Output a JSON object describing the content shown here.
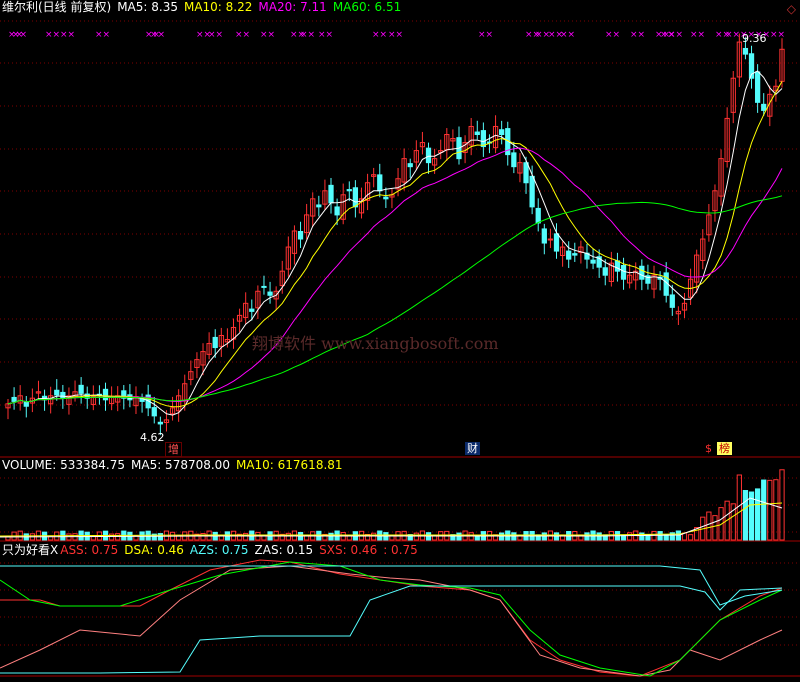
{
  "header": {
    "title": "维尔利(日线 前复权)",
    "ma5": "MA5: 8.35",
    "ma10": "MA10: 8.22",
    "ma20": "MA20: 7.11",
    "ma60": "MA60: 6.51"
  },
  "volume_header": {
    "title": "VOLUME: 533384.75",
    "ma5": "MA5: 578708.00",
    "ma10": "MA10: 617618.81"
  },
  "indicator_header": {
    "title": "只为好看X",
    "ass": "ASS: 0.75",
    "dsa": "DSA: 0.46",
    "azs": "AZS: 0.75",
    "zas": "ZAS: 0.15",
    "sxs": "SXS: 0.46",
    "extra": ": 0.75"
  },
  "annotations": {
    "low_label": "4.62",
    "high_label": "9.36",
    "badge_zeng": "增",
    "badge_cai": "财",
    "badge_s": "$",
    "badge_bang": "榜",
    "corner_icon": "◇",
    "watermark": "翔博软件 www.xiangbosoft.com"
  },
  "colors": {
    "up": "#ff3232",
    "down": "#54fcfc",
    "ma5": "#ffffff",
    "ma10": "#ffff00",
    "ma20": "#ff00ff",
    "ma60": "#00ff00",
    "grid": "#800000",
    "signal": "#ff00ff"
  },
  "chart_data": [
    {
      "type": "candlestick",
      "title": "维尔利(日线 前复权)",
      "series": [
        {
          "name": "MA5",
          "last": 8.35
        },
        {
          "name": "MA10",
          "last": 8.22
        },
        {
          "name": "MA20",
          "last": 7.11
        },
        {
          "name": "MA60",
          "last": 6.51
        }
      ],
      "close": [
        4.95,
        4.98,
        5.05,
        4.92,
        5.02,
        5.1,
        5.0,
        5.05,
        5.06,
        5.02,
        5.05,
        5.1,
        5.08,
        5.02,
        5.04,
        5.06,
        5.0,
        5.03,
        5.05,
        5.02,
        5.0,
        5.04,
        4.98,
        4.9,
        4.8,
        4.7,
        4.75,
        4.9,
        5.05,
        5.2,
        5.35,
        5.5,
        5.6,
        5.7,
        5.65,
        5.8,
        5.75,
        5.9,
        6.05,
        6.2,
        6.1,
        6.35,
        6.4,
        6.3,
        6.35,
        6.6,
        6.9,
        7.1,
        7.0,
        7.3,
        7.5,
        7.4,
        7.6,
        7.45,
        7.3,
        7.55,
        7.6,
        7.4,
        7.5,
        7.7,
        7.8,
        7.6,
        7.5,
        7.55,
        7.75,
        8.0,
        7.9,
        8.1,
        8.2,
        7.95,
        8.0,
        8.1,
        8.3,
        8.25,
        8.0,
        8.2,
        8.4,
        8.3,
        8.15,
        8.2,
        8.4,
        8.3,
        8.05,
        7.9,
        7.95,
        7.7,
        7.4,
        7.2,
        6.95,
        7.0,
        6.85,
        6.9,
        6.75,
        6.8,
        6.9,
        6.75,
        6.7,
        6.65,
        6.55,
        6.7,
        6.6,
        6.5,
        6.55,
        6.6,
        6.5,
        6.45,
        6.55,
        6.5,
        6.3,
        6.15,
        6.1,
        6.2,
        6.5,
        6.8,
        7.0,
        7.3,
        7.6,
        8.0,
        8.5,
        9.0,
        9.45,
        9.3,
        9.0,
        8.7,
        8.6,
        8.8,
        8.9,
        9.36
      ],
      "low_marker": 4.62,
      "high_marker": 9.36
    },
    {
      "type": "bar",
      "title": "VOLUME",
      "series": [
        {
          "name": "VOLUME",
          "last": 533384.75
        },
        {
          "name": "MA5",
          "last": 578708.0
        },
        {
          "name": "MA10",
          "last": 617618.81
        }
      ]
    },
    {
      "type": "line",
      "title": "只为好看X",
      "series": [
        {
          "name": "ASS",
          "last": 0.75
        },
        {
          "name": "DSA",
          "last": 0.46
        },
        {
          "name": "AZS",
          "last": 0.75
        },
        {
          "name": "ZAS",
          "last": 0.15
        },
        {
          "name": "SXS",
          "last": 0.46
        }
      ]
    }
  ]
}
